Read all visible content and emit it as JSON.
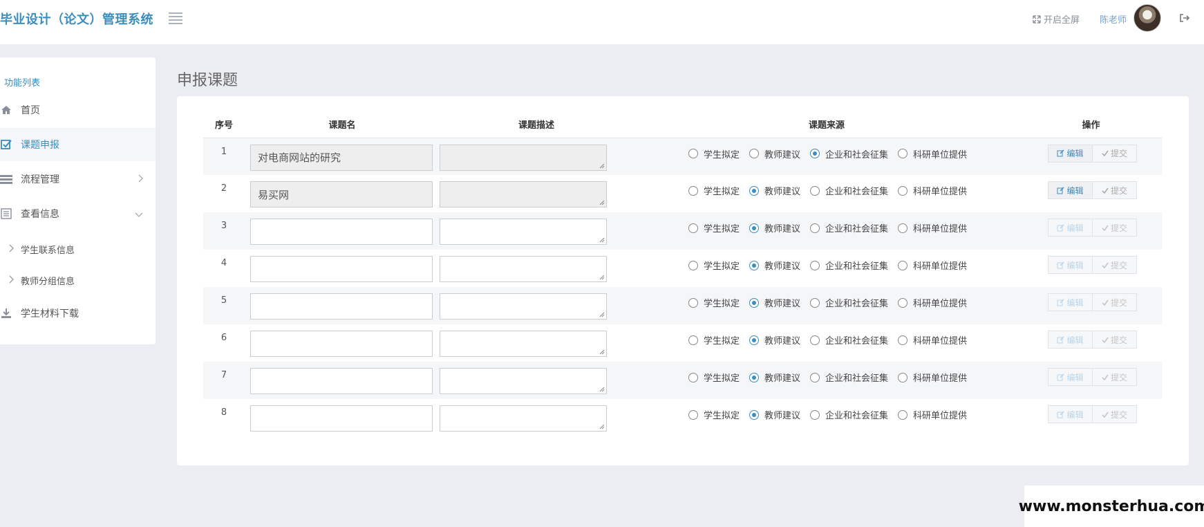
{
  "header": {
    "brand": "毕业设计（论文）管理系统",
    "fullscreen_label": "开启全屏",
    "user_name": "陈老师"
  },
  "sidebar": {
    "title": "功能列表",
    "items": [
      {
        "label": "首页",
        "icon": "home-icon"
      },
      {
        "label": "课题申报",
        "icon": "check-square-icon",
        "active": true
      },
      {
        "label": "流程管理",
        "icon": "list-icon"
      },
      {
        "label": "查看信息",
        "icon": "document-icon"
      },
      {
        "label": "学生联系信息"
      },
      {
        "label": "教师分组信息"
      },
      {
        "label": "学生材料下载",
        "icon": "download-icon"
      }
    ]
  },
  "page": {
    "title": "申报课题"
  },
  "table": {
    "headers": [
      "序号",
      "课题名",
      "课题描述",
      "课题来源",
      "操作"
    ],
    "source_options": [
      "学生拟定",
      "教师建议",
      "企业和社会征集",
      "科研单位提供"
    ],
    "edit_label": "编辑",
    "submit_label": "提交",
    "rows": [
      {
        "index": "1",
        "name": "对电商网站的研究",
        "description": "",
        "source": "企业和社会征集",
        "readonly": true,
        "enabled": true
      },
      {
        "index": "2",
        "name": "易买网",
        "description": "",
        "source": "教师建议",
        "readonly": true,
        "enabled": true
      },
      {
        "index": "3",
        "name": "",
        "description": "",
        "source": "教师建议",
        "readonly": false,
        "enabled": false
      },
      {
        "index": "4",
        "name": "",
        "description": "",
        "source": "教师建议",
        "readonly": false,
        "enabled": false
      },
      {
        "index": "5",
        "name": "",
        "description": "",
        "source": "教师建议",
        "readonly": false,
        "enabled": false
      },
      {
        "index": "6",
        "name": "",
        "description": "",
        "source": "教师建议",
        "readonly": false,
        "enabled": false
      },
      {
        "index": "7",
        "name": "",
        "description": "",
        "source": "教师建议",
        "readonly": false,
        "enabled": false
      },
      {
        "index": "8",
        "name": "",
        "description": "",
        "source": "教师建议",
        "readonly": false,
        "enabled": false
      }
    ]
  },
  "watermark": "www.monsterhua.com",
  "colors": {
    "accent": "#3c8dbc",
    "background": "#ebedf3",
    "panel": "#ffffff"
  }
}
